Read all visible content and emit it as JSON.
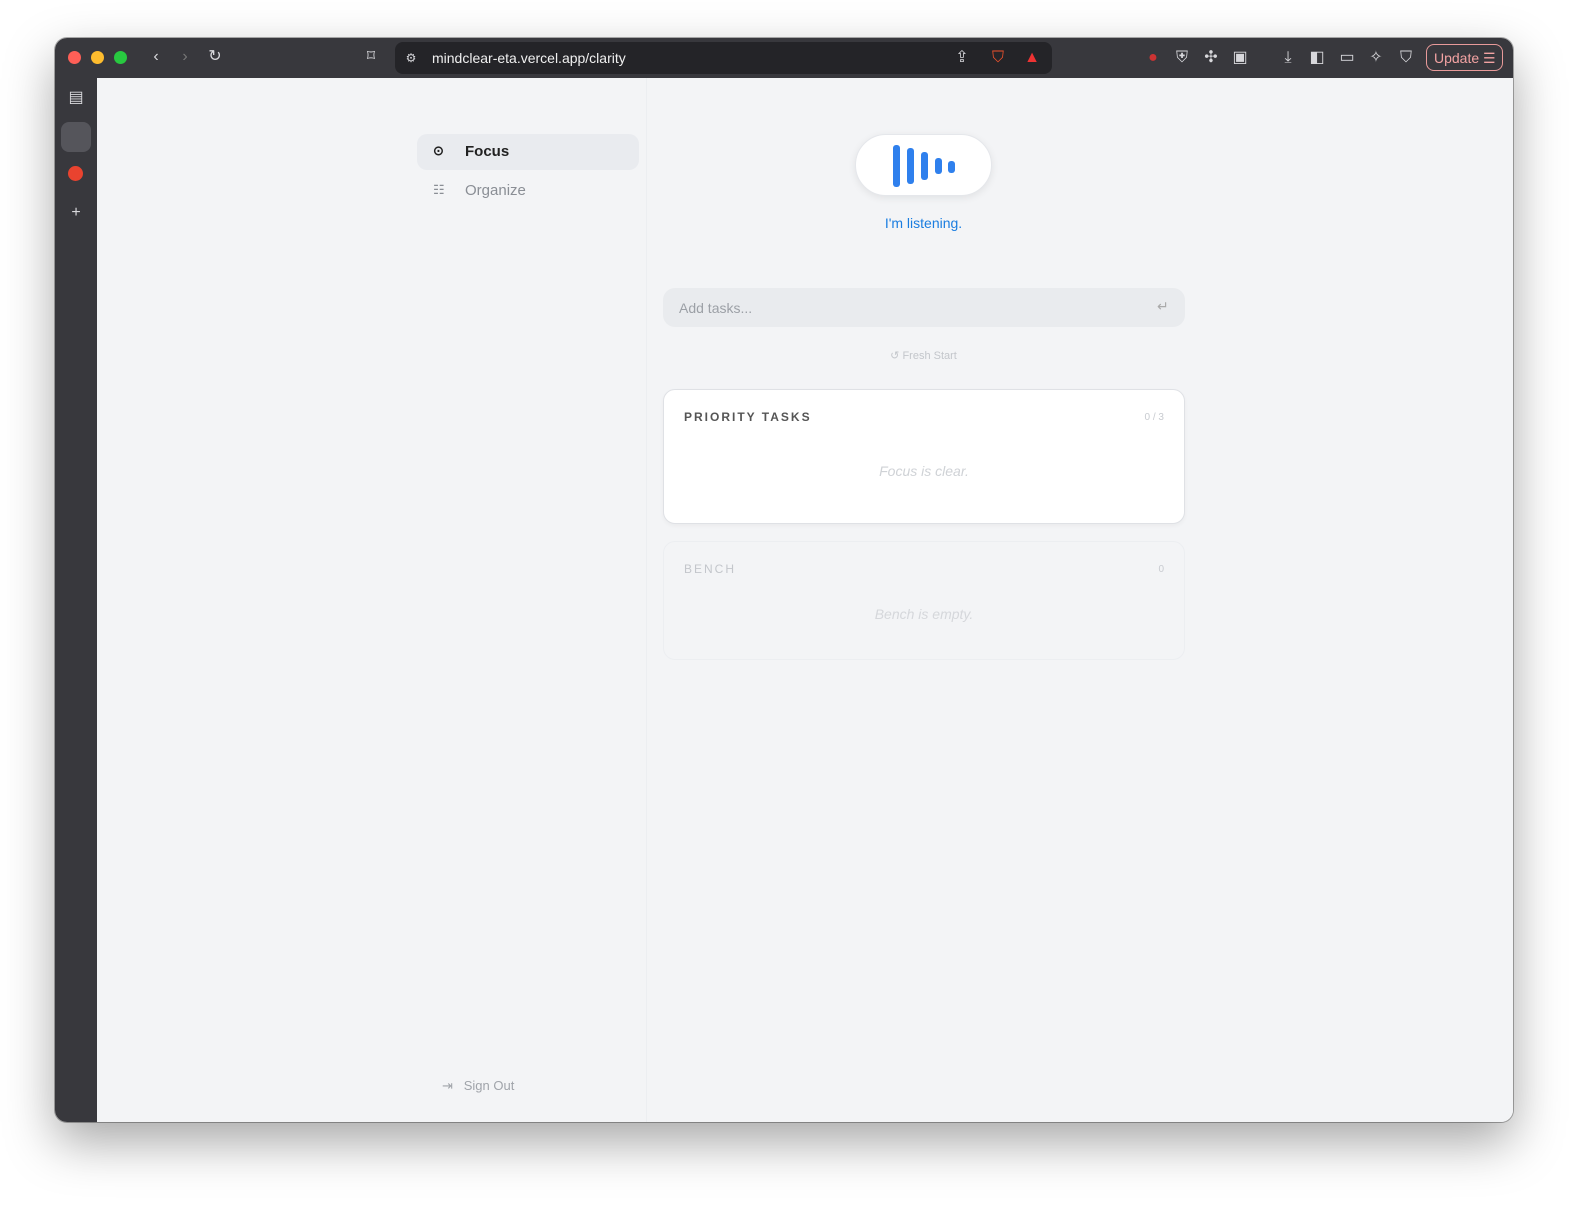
{
  "browser": {
    "url": "mindclear-eta.vercel.app/clarity",
    "update_label": "Update"
  },
  "nav": {
    "items": [
      {
        "label": "Focus",
        "active": true
      },
      {
        "label": "Organize",
        "active": false
      }
    ],
    "sign_out": "Sign Out"
  },
  "voice": {
    "status": "I'm listening.",
    "accent": "#2f80ed"
  },
  "input": {
    "placeholder": "Add tasks...",
    "value": ""
  },
  "fresh_start": "Fresh Start",
  "priority": {
    "title": "PRIORITY TASKS",
    "count": "0 / 3",
    "empty": "Focus is clear."
  },
  "bench": {
    "title": "BENCH",
    "count": "0",
    "empty": "Bench is empty."
  }
}
